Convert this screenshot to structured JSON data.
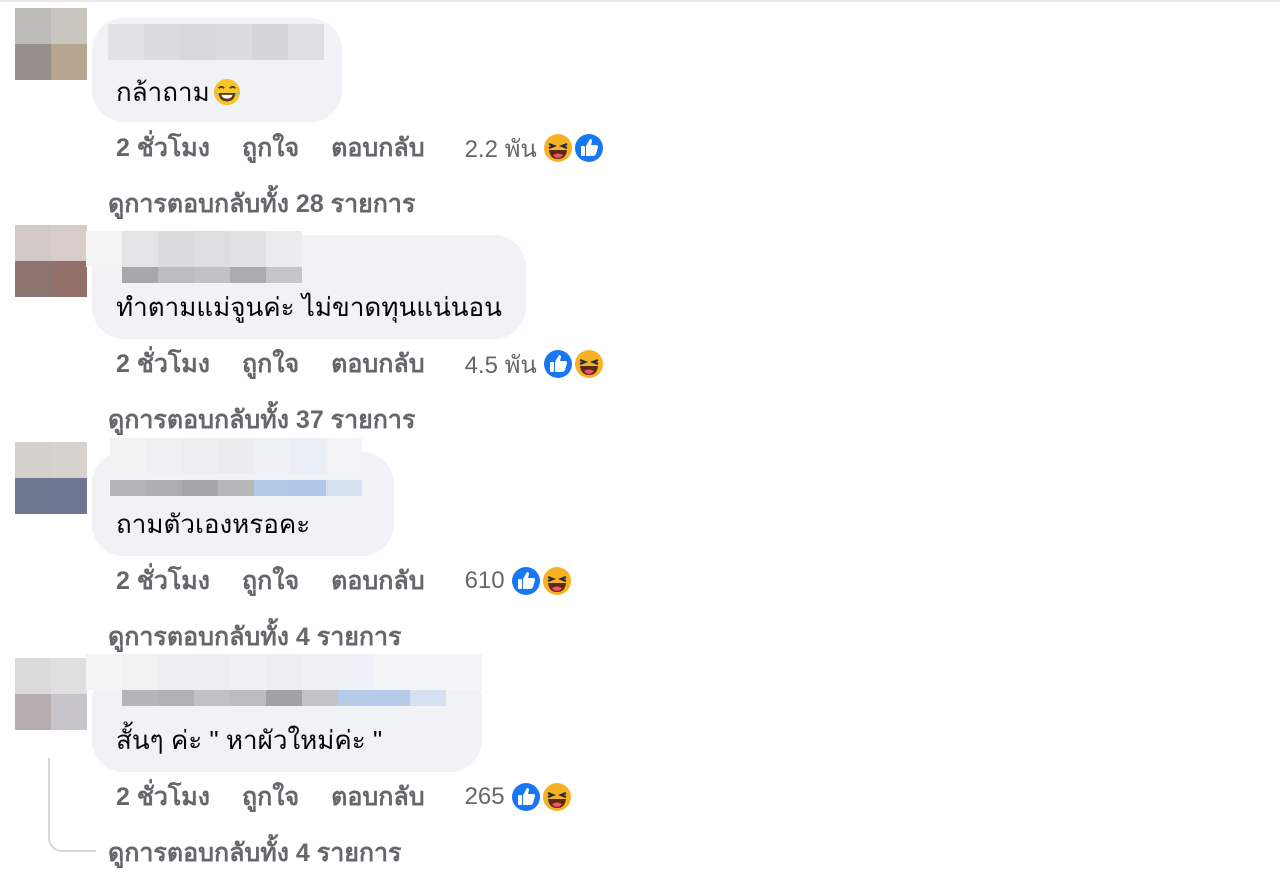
{
  "colors": {
    "bubble": "#f0f2f5",
    "meta_text": "#65676b",
    "like_blue": "#1877f2",
    "haha_yellow": "#f7b125"
  },
  "comments": [
    {
      "text": "กล้าถาม",
      "text_emoji": "laughing-tears-icon",
      "time": "2 ชั่วโมง",
      "like_label": "ถูกใจ",
      "reply_label": "ตอบกลับ",
      "reaction_count": "2.2 พัน",
      "reactions": [
        "haha-icon",
        "like-icon"
      ],
      "view_replies": "ดูการตอบกลับทั้ง 28 รายการ"
    },
    {
      "text": "ทำตามแม่จูนค่ะ ไม่ขาดทุนแน่นอน",
      "time": "2 ชั่วโมง",
      "like_label": "ถูกใจ",
      "reply_label": "ตอบกลับ",
      "reaction_count": "4.5 พัน",
      "reactions": [
        "like-icon",
        "haha-icon"
      ],
      "view_replies": "ดูการตอบกลับทั้ง 37 รายการ"
    },
    {
      "text": "ถามตัวเองหรอคะ",
      "time": "2 ชั่วโมง",
      "like_label": "ถูกใจ",
      "reply_label": "ตอบกลับ",
      "reaction_count": "610",
      "reactions": [
        "like-icon",
        "haha-icon"
      ],
      "view_replies": "ดูการตอบกลับทั้ง 4 รายการ"
    },
    {
      "text": "สั้นๆ ค่ะ \" หาผัวใหม่ค่ะ \"",
      "time": "2 ชั่วโมง",
      "like_label": "ถูกใจ",
      "reply_label": "ตอบกลับ",
      "reaction_count": "265",
      "reactions": [
        "like-icon",
        "haha-icon"
      ],
      "view_replies": "ดูการตอบกลับทั้ง 4 รายการ"
    }
  ]
}
